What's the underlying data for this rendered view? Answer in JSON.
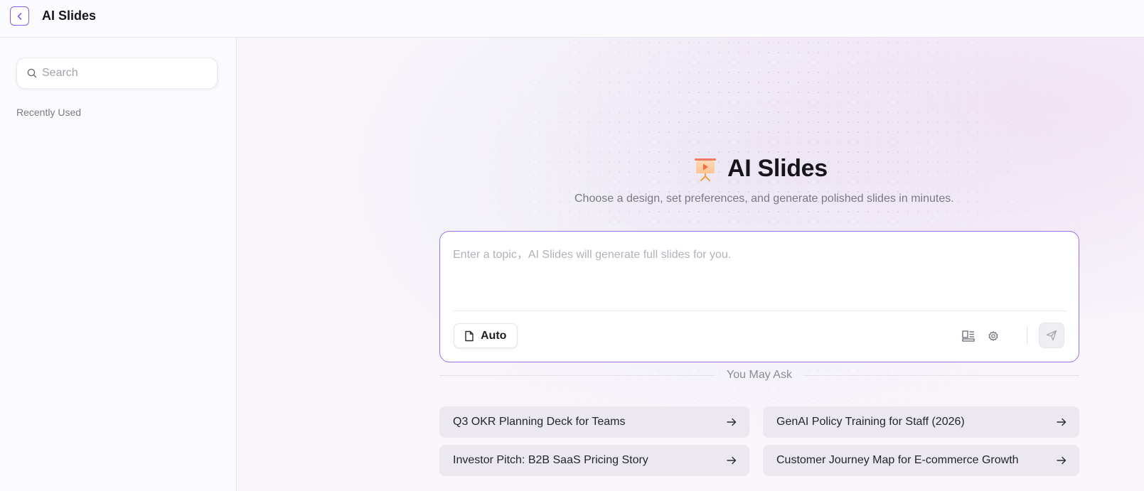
{
  "header": {
    "title": "AI Slides",
    "back_icon": "chevron-left-icon"
  },
  "sidebar": {
    "search_placeholder": "Search",
    "recently_used_label": "Recently Used"
  },
  "hero": {
    "title": "AI Slides",
    "subtitle": "Choose a design, set preferences, and generate polished slides in minutes.",
    "logo_icon": "presentation-board-icon"
  },
  "composer": {
    "placeholder": "Enter a topic，AI Slides will generate full slides for you.",
    "value": "",
    "auto_label": "Auto"
  },
  "you_may_ask": {
    "label": "You May Ask",
    "items": [
      {
        "label": "Q3 OKR Planning Deck for Teams"
      },
      {
        "label": "GenAI Policy Training for Staff (2026)"
      },
      {
        "label": "Investor Pitch: B2B SaaS Pricing Story"
      },
      {
        "label": "Customer Journey Map for E-commerce Growth"
      }
    ]
  },
  "colors": {
    "accent": "#8a5cf0",
    "composer_border": "#9b6ff2",
    "suggestion_bg": "#ebe8f0"
  }
}
